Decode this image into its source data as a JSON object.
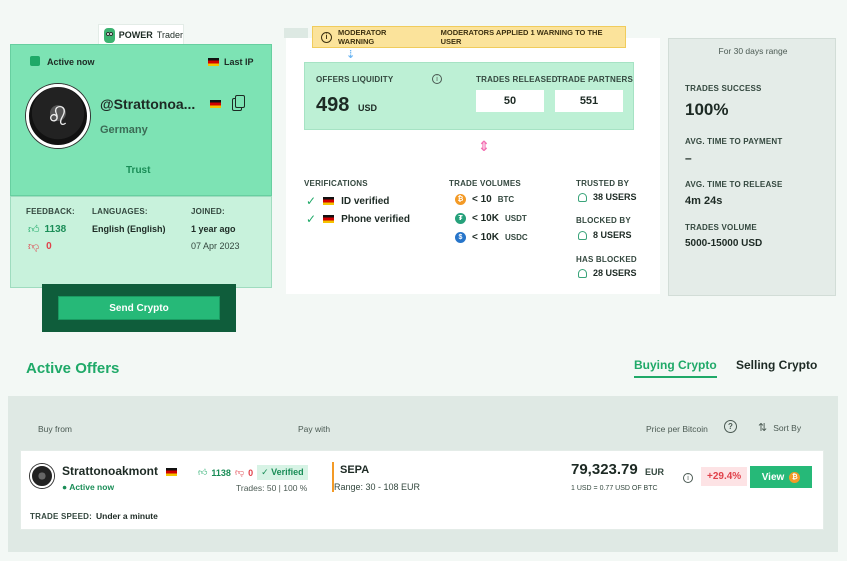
{
  "badge": {
    "title": "POWER",
    "subtitle": "Trader"
  },
  "profile": {
    "status": "Active now",
    "last_ip_label": "Last IP",
    "username": "@Strattonoa...",
    "country": "Germany",
    "trust": "Trust",
    "feedback_label": "FEEDBACK:",
    "likes": "1138",
    "dislikes": "0",
    "languages_label": "LANGUAGES:",
    "languages": "English (English)",
    "joined_label": "JOINED:",
    "joined_ago": "1 year ago",
    "joined_date": "07 Apr 2023",
    "send_button": "Send Crypto"
  },
  "warning": {
    "title": "MODERATOR WARNING",
    "text": "MODERATORS APPLIED 1 WARNING TO THE USER"
  },
  "liquidity": {
    "label": "OFFERS LIQUIDITY",
    "value": "498",
    "currency": "USD",
    "released_label": "TRADES RELEASED",
    "released": "50",
    "partners_label": "TRADE PARTNERS",
    "partners": "551"
  },
  "verifications": {
    "label": "VERIFICATIONS",
    "items": [
      "ID verified",
      "Phone verified"
    ]
  },
  "volumes": {
    "label": "TRADE VOLUMES",
    "items": [
      {
        "amount": "< 10",
        "unit": "BTC",
        "color": "#f39a26"
      },
      {
        "amount": "< 10K",
        "unit": "USDT",
        "color": "#26a17b"
      },
      {
        "amount": "< 10K",
        "unit": "USDC",
        "color": "#2775ca"
      }
    ]
  },
  "relations": {
    "trusted_label": "TRUSTED BY",
    "trusted": "38 USERS",
    "blocked_label": "BLOCKED BY",
    "blocked": "8 USERS",
    "has_blocked_label": "HAS BLOCKED",
    "has_blocked": "28 USERS"
  },
  "stats": {
    "header": "For 30 days range",
    "success_label": "TRADES SUCCESS",
    "success": "100%",
    "payment_label": "AVG. TIME TO PAYMENT",
    "payment": "–",
    "release_label": "AVG. TIME TO RELEASE",
    "release": "4m 24s",
    "volume_label": "TRADES VOLUME",
    "volume": "5000-15000 USD"
  },
  "offers": {
    "title": "Active Offers",
    "tab_buy": "Buying Crypto",
    "tab_sell": "Selling Crypto",
    "col_buy_from": "Buy from",
    "col_pay_with": "Pay with",
    "col_price": "Price per Bitcoin",
    "sort_by": "Sort By",
    "row": {
      "trader": "Strattonoakmont",
      "status": "Active now",
      "likes": "1138",
      "dislikes": "0",
      "verified": "Verified",
      "trades": "Trades: 50 | 100 %",
      "method": "SEPA",
      "range": "Range: 30 - 108 EUR",
      "price": "79,323.79",
      "price_currency": "EUR",
      "rate": "1 USD = 0.77 USD OF BTC",
      "percent": "+29.4%",
      "view": "View",
      "trade_speed_label": "TRADE SPEED:",
      "trade_speed": "Under a minute"
    }
  }
}
